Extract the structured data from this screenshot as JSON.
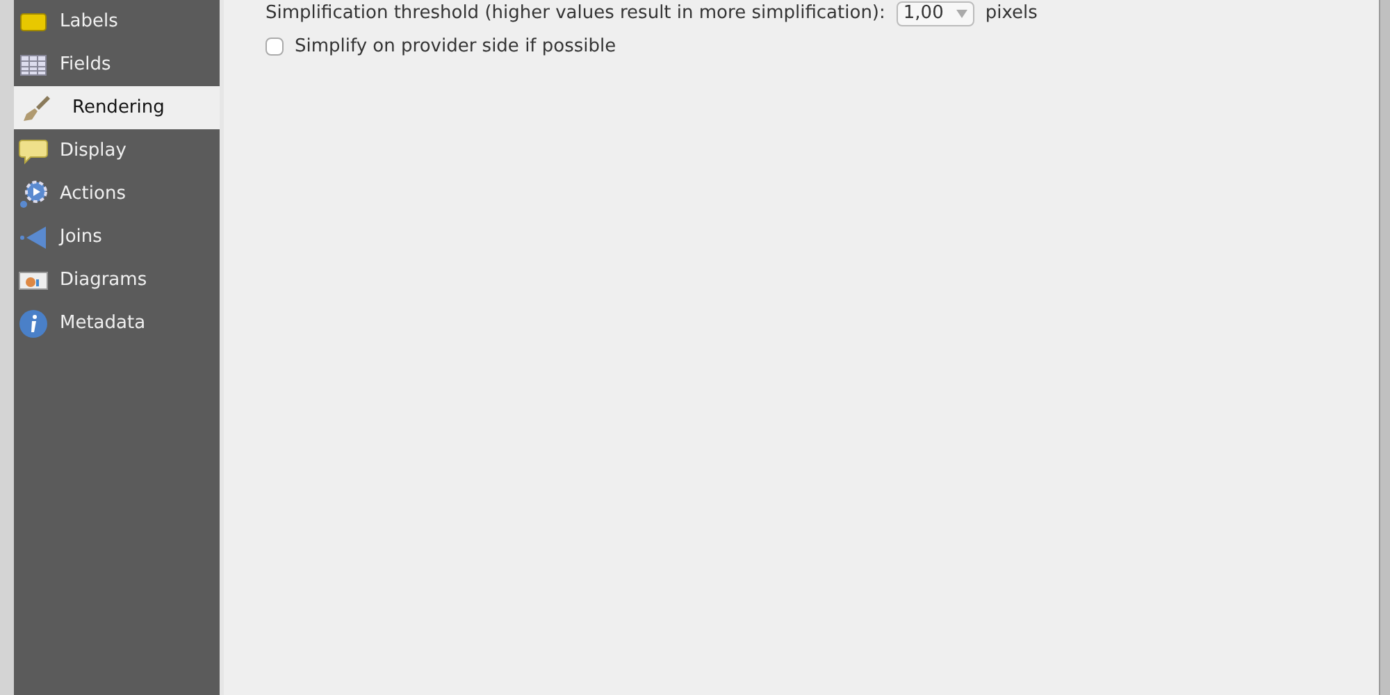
{
  "sidebar": {
    "items": [
      {
        "label": "Labels",
        "selected": false
      },
      {
        "label": "Fields",
        "selected": false
      },
      {
        "label": "Rendering",
        "selected": true
      },
      {
        "label": "Display",
        "selected": false
      },
      {
        "label": "Actions",
        "selected": false
      },
      {
        "label": "Joins",
        "selected": false
      },
      {
        "label": "Diagrams",
        "selected": false
      },
      {
        "label": "Metadata",
        "selected": false
      }
    ]
  },
  "threshold": {
    "label": "Simplification threshold (higher values result in more simplification):",
    "value": "1,00",
    "unit": "pixels"
  },
  "provider_option": {
    "label": "Simplify on provider side if possible",
    "checked": false
  }
}
